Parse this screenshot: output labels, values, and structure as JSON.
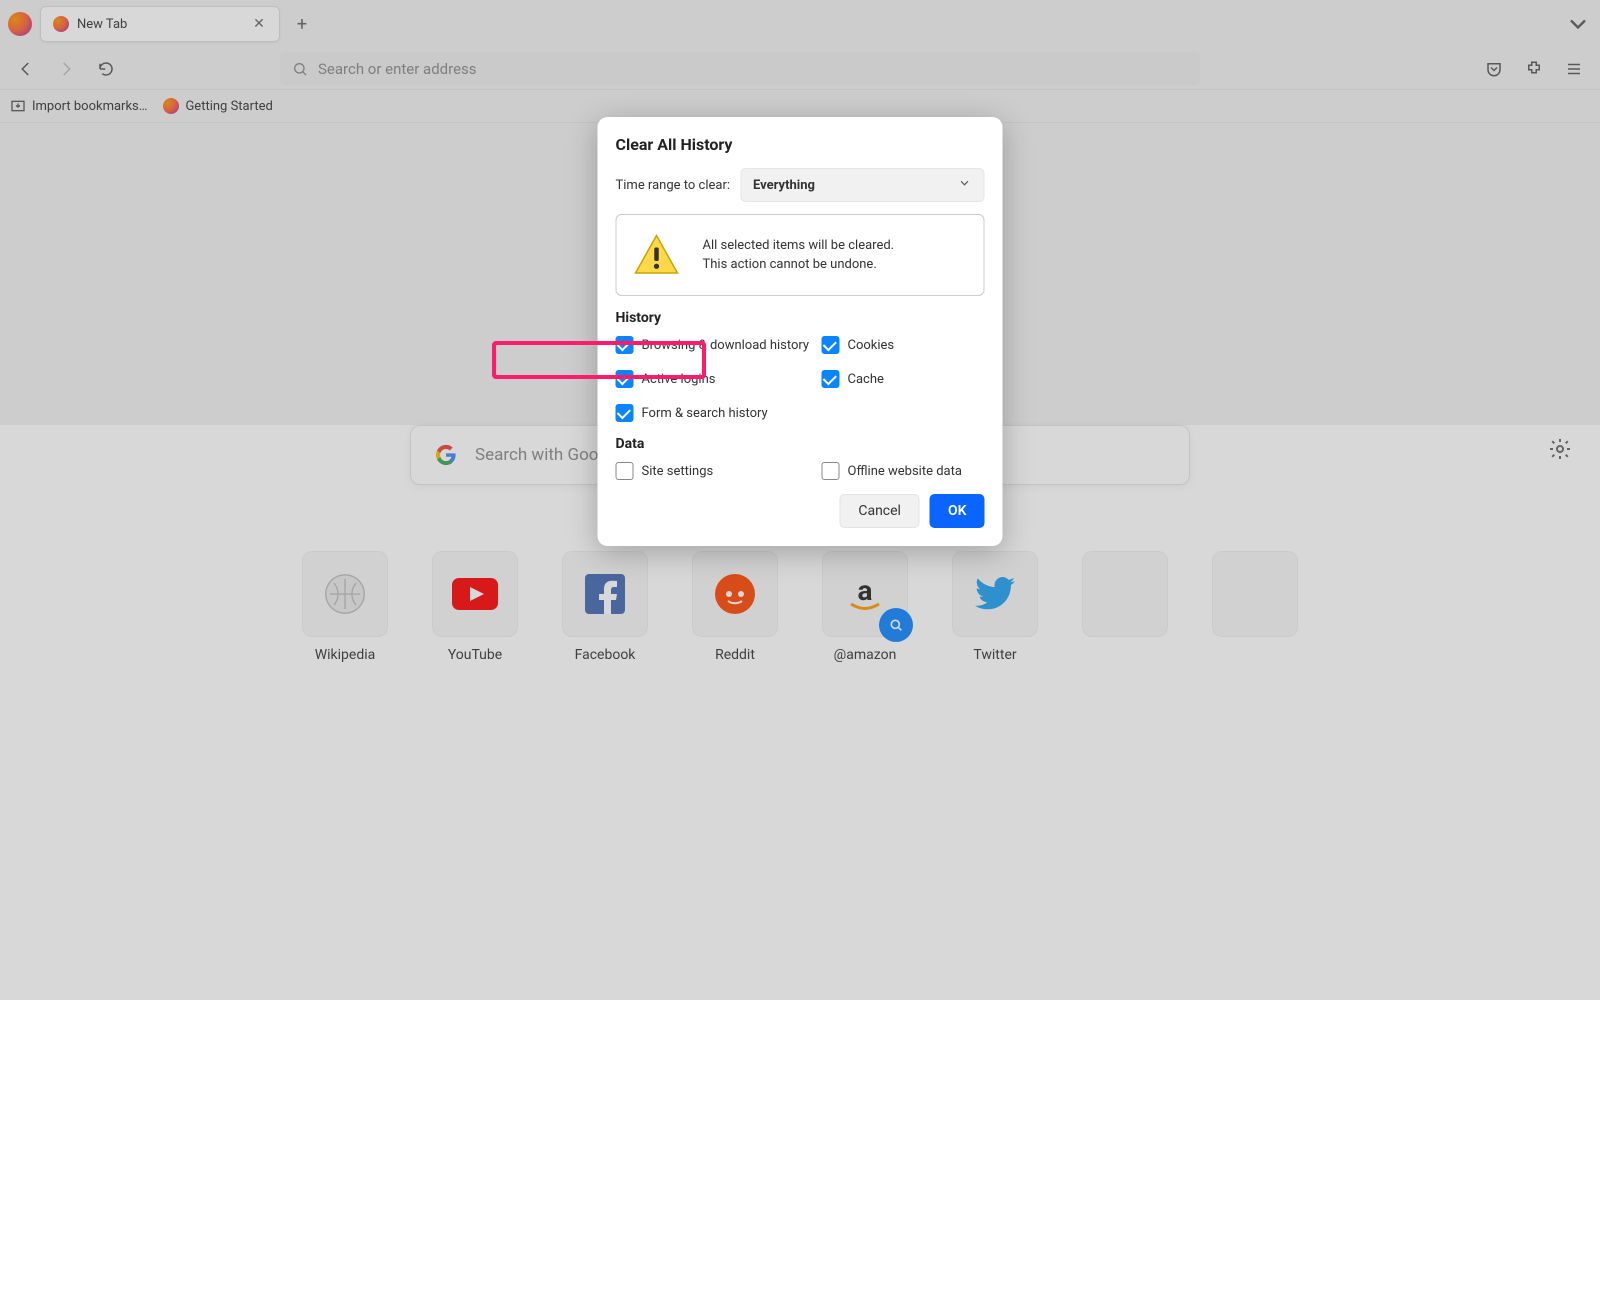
{
  "tab": {
    "title": "New Tab"
  },
  "urlbar": {
    "placeholder": "Search or enter address"
  },
  "bookmarks": {
    "import": "Import bookmarks…",
    "getting_started": "Getting Started"
  },
  "center_search": {
    "placeholder": "Search with Google or enter address"
  },
  "tiles": [
    {
      "label": "Wikipedia"
    },
    {
      "label": "YouTube"
    },
    {
      "label": "Facebook"
    },
    {
      "label": "Reddit"
    },
    {
      "label": "@amazon"
    },
    {
      "label": "Twitter"
    },
    {
      "label": ""
    },
    {
      "label": ""
    }
  ],
  "dialog": {
    "title": "Clear All History",
    "range_label": "Time range to clear:",
    "range_value": "Everything",
    "warning_line1": "All selected items will be cleared.",
    "warning_line2": "This action cannot be undone.",
    "history_heading": "History",
    "data_heading": "Data",
    "checks": {
      "browsing": "Browsing & download history",
      "cookies": "Cookies",
      "active_logins": "Active logins",
      "cache": "Cache",
      "form_search": "Form & search history",
      "site_settings": "Site settings",
      "offline_data": "Offline website data"
    },
    "cancel": "Cancel",
    "ok": "OK"
  }
}
